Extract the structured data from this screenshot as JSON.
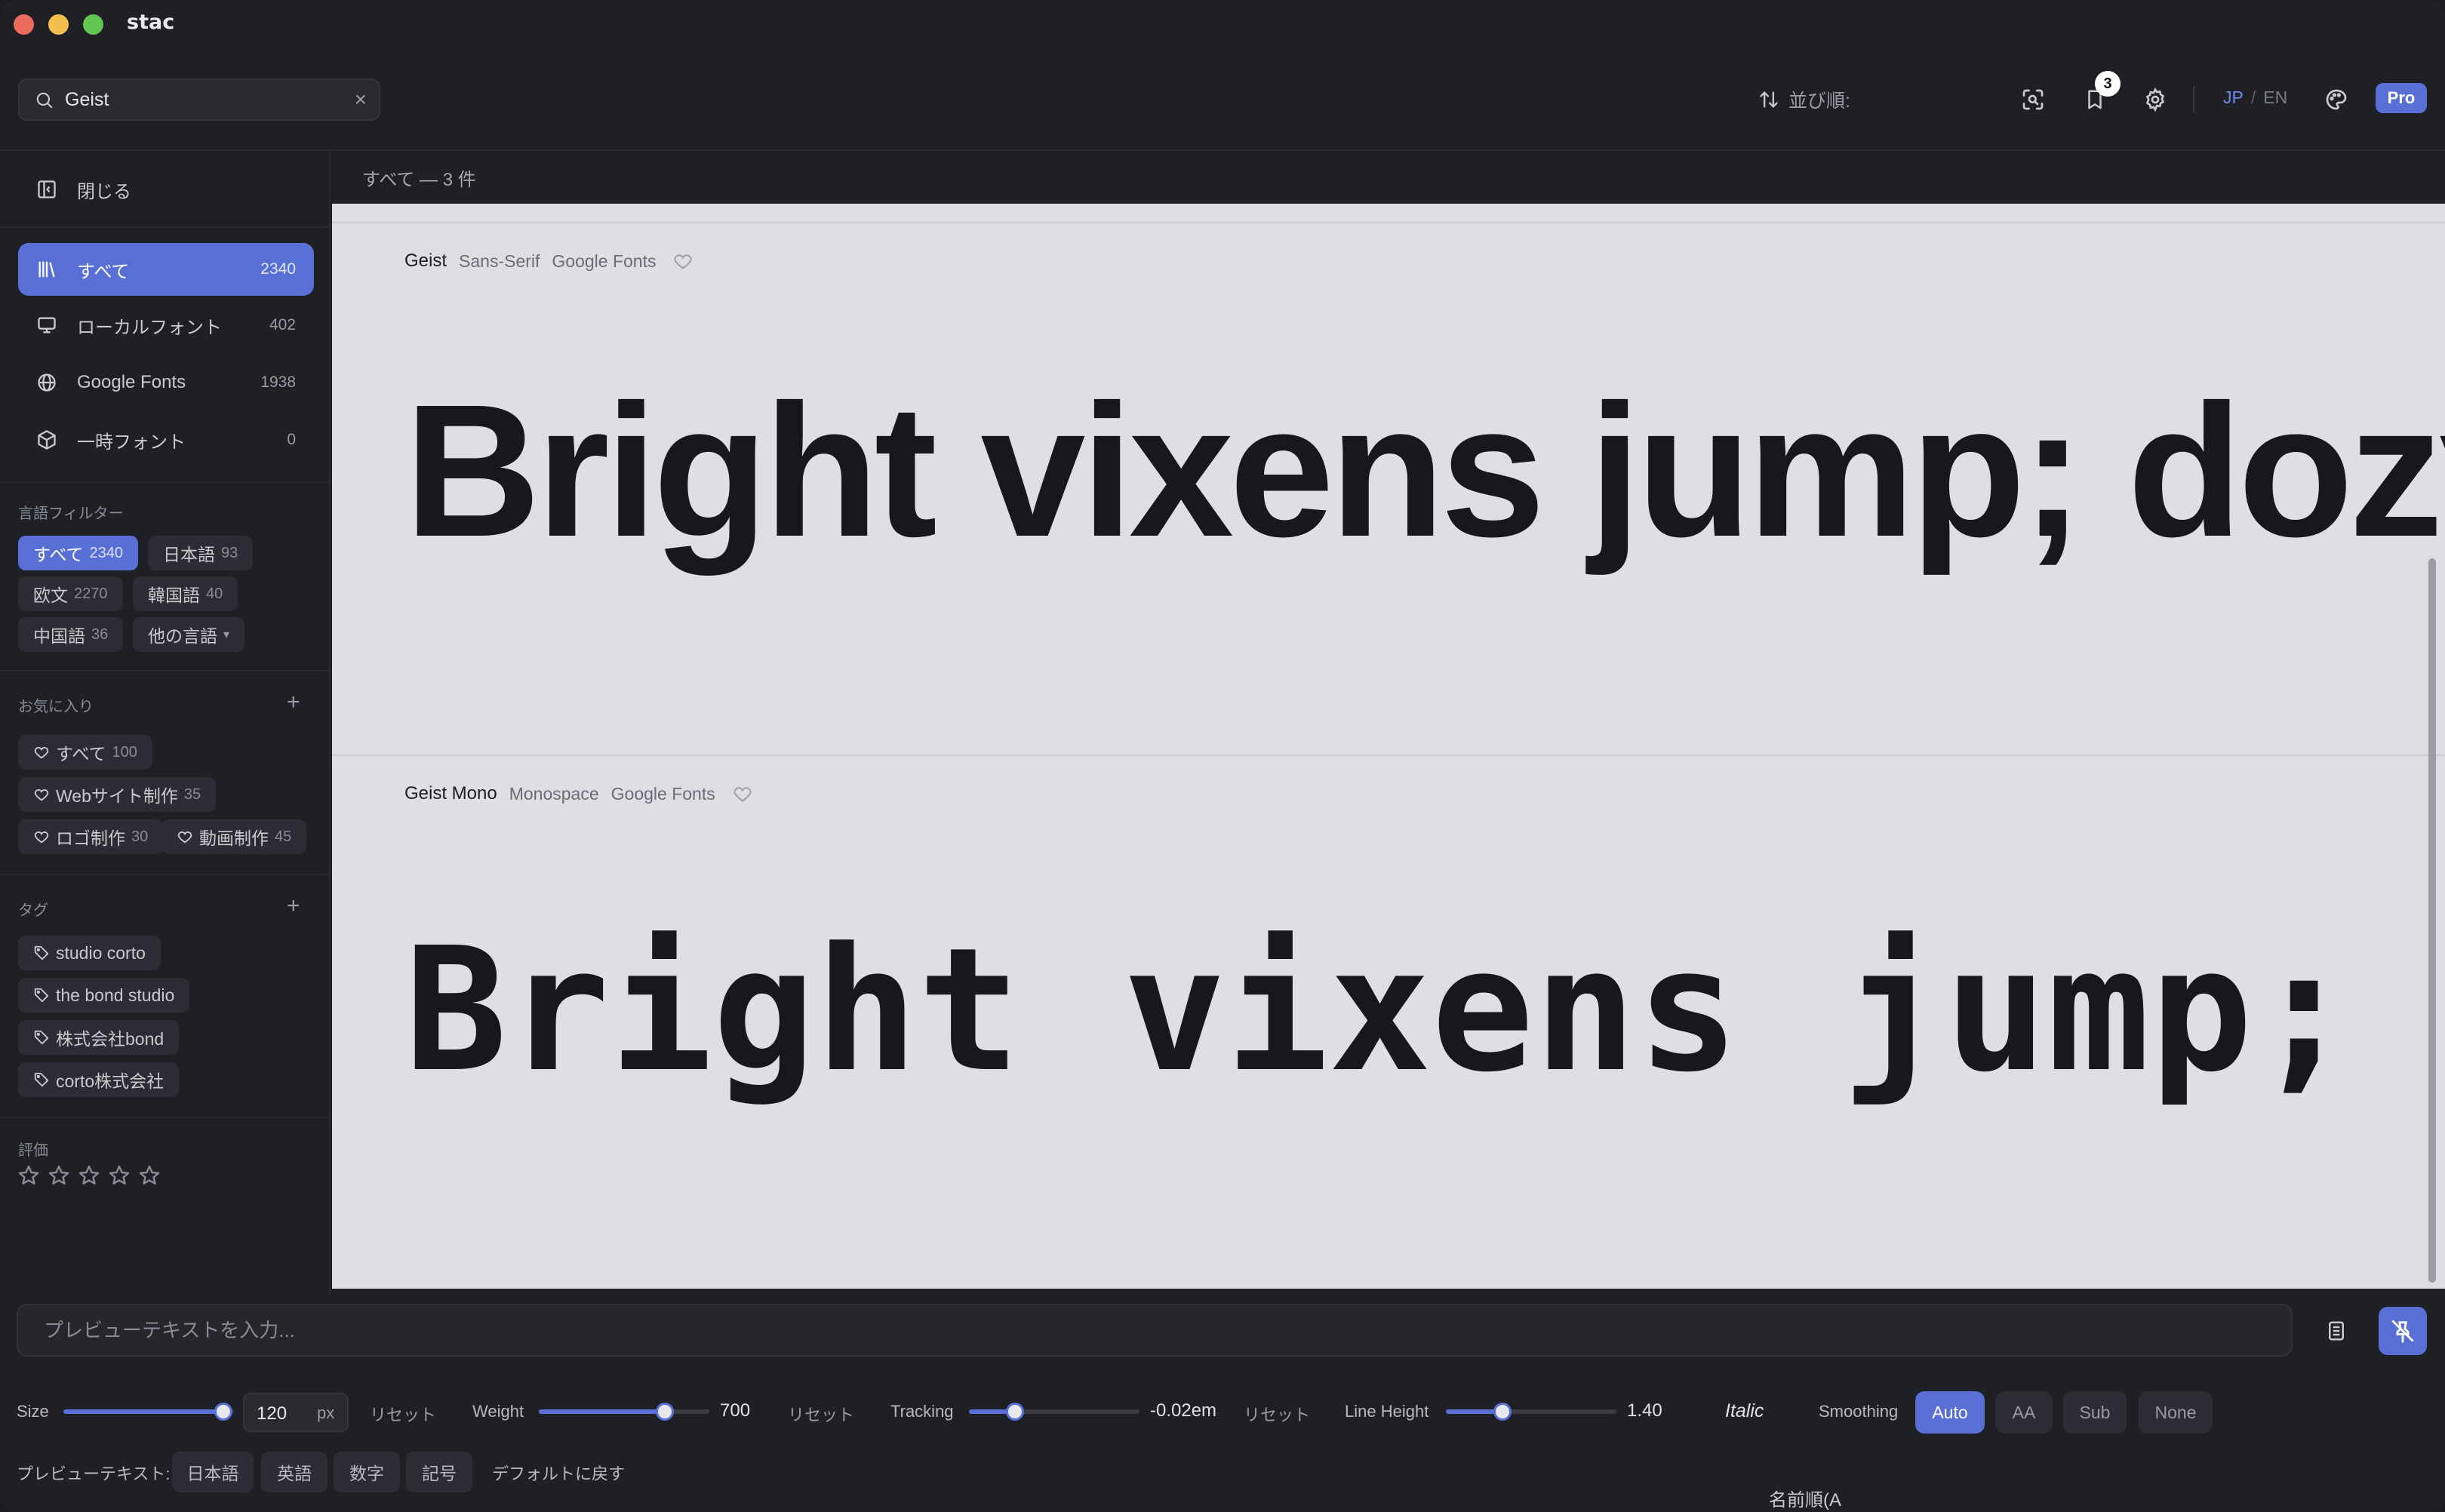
{
  "app": {
    "title": "stac"
  },
  "search": {
    "value": "Geist"
  },
  "toolbar": {
    "sort_label": "並び順:",
    "sort_value": "名前順(A → Z)",
    "bookmark_count": "3",
    "lang_jp": "JP",
    "lang_sep": "/",
    "lang_en": "EN",
    "pro_label": "Pro"
  },
  "sidebar": {
    "close_label": "閉じる",
    "nav": [
      {
        "label": "すべて",
        "count": "2340"
      },
      {
        "label": "ローカルフォント",
        "count": "402"
      },
      {
        "label": "Google Fonts",
        "count": "1938"
      },
      {
        "label": "一時フォント",
        "count": "0"
      }
    ],
    "language_filter": {
      "title": "言語フィルター",
      "chips": [
        {
          "label": "すべて",
          "count": "2340"
        },
        {
          "label": "日本語",
          "count": "93"
        },
        {
          "label": "欧文",
          "count": "2270"
        },
        {
          "label": "韓国語",
          "count": "40"
        },
        {
          "label": "中国語",
          "count": "36"
        },
        {
          "label": "他の言語"
        }
      ]
    },
    "favorites": {
      "title": "お気に入り",
      "chips": [
        {
          "label": "すべて",
          "count": "100"
        },
        {
          "label": "Webサイト制作",
          "count": "35"
        },
        {
          "label": "ロゴ制作",
          "count": "30"
        },
        {
          "label": "動画制作",
          "count": "45"
        }
      ]
    },
    "tags": {
      "title": "タグ",
      "items": [
        "studio corto",
        "the bond studio",
        "株式会社bond",
        "corto株式会社"
      ]
    },
    "rating": {
      "title": "評価",
      "value": 0,
      "max": 5
    }
  },
  "main": {
    "result_label": "すべて — 3 件",
    "fonts": [
      {
        "name": "Geist",
        "category": "Sans-Serif",
        "source": "Google Fonts",
        "sample": "Bright vixens jump; dozy"
      },
      {
        "name": "Geist Mono",
        "category": "Monospace",
        "source": "Google Fonts",
        "sample": "Bright vixens jump;"
      }
    ]
  },
  "controls": {
    "preview_placeholder": "プレビューテキストを入力...",
    "size": {
      "label": "Size",
      "value": "120",
      "unit": "px",
      "reset": "リセット",
      "fraction": 0.94
    },
    "weight": {
      "label": "Weight",
      "value": "700",
      "reset": "リセット",
      "fraction": 0.74
    },
    "tracking": {
      "label": "Tracking",
      "value": "-0.02em",
      "reset": "リセット",
      "fraction": 0.27
    },
    "line_height": {
      "label": "Line Height",
      "value": "1.40",
      "fraction": 0.33
    },
    "italic_label": "Italic",
    "smoothing": {
      "label": "Smoothing",
      "options": [
        "Auto",
        "AA",
        "Sub",
        "None"
      ],
      "selected": "Auto"
    },
    "preview_text": {
      "label": "プレビューテキスト:",
      "options": [
        "日本語",
        "英語",
        "数字",
        "記号"
      ],
      "default_label": "デフォルトに戻す"
    }
  },
  "colors": {
    "accent": "#5870d6",
    "content_bg": "#dedfe4",
    "window_bg": "#1f2026"
  }
}
